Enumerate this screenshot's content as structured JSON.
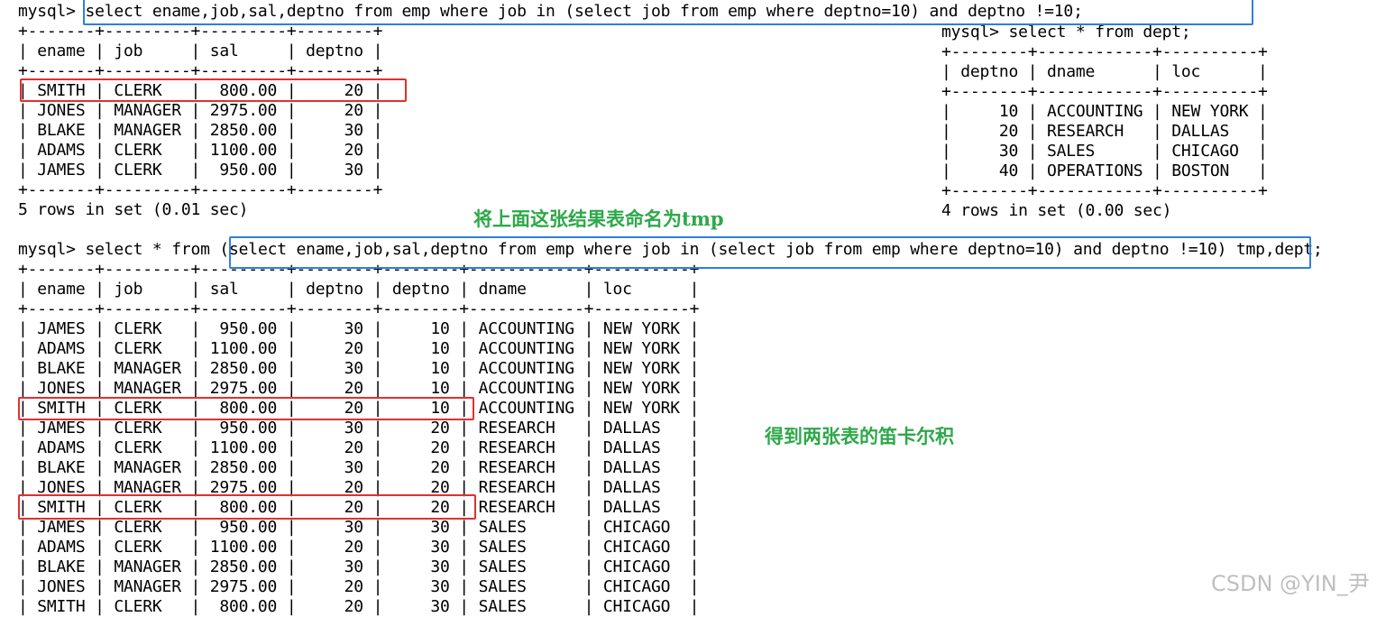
{
  "colors": {
    "terminal_text": "#000000",
    "annotation_green": "#2ea84a",
    "highlight_blue": "#2f7fdc",
    "highlight_red": "#e03030",
    "watermark": "#bfbfbf"
  },
  "query1": {
    "prompt": "mysql>",
    "sql": "select ename,job,sal,deptno from emp where job in (select job from emp where deptno=10) and deptno !=10;",
    "lines": [
      "+-------+---------+---------+--------+",
      "| ename | job     | sal     | deptno |",
      "+-------+---------+---------+--------+",
      "| SMITH | CLERK   |  800.00 |     20 |",
      "| JONES | MANAGER | 2975.00 |     20 |",
      "| BLAKE | MANAGER | 2850.00 |     30 |",
      "| ADAMS | CLERK   | 1100.00 |     20 |",
      "| JAMES | CLERK   |  950.00 |     30 |",
      "+-------+---------+---------+--------+",
      "5 rows in set (0.01 sec)"
    ]
  },
  "query2": {
    "prompt": "mysql> select * from dept;",
    "lines": [
      "+--------+------------+----------+",
      "| deptno | dname      | loc      |",
      "+--------+------------+----------+",
      "|     10 | ACCOUNTING | NEW YORK |",
      "|     20 | RESEARCH   | DALLAS   |",
      "|     30 | SALES      | CHICAGO  |",
      "|     40 | OPERATIONS | BOSTON   |",
      "+--------+------------+----------+",
      "4 rows in set (0.00 sec)"
    ]
  },
  "query3": {
    "prompt": "mysql> select * from",
    "sql": "(select ename,job,sal,deptno from emp where job in (select job from emp where deptno=10) and deptno !=10) tmp",
    "suffix": ",dept;",
    "lines": [
      "+-------+---------+---------+--------+--------+------------+----------+",
      "| ename | job     | sal     | deptno | deptno | dname      | loc      |",
      "+-------+---------+---------+--------+--------+------------+----------+",
      "| JAMES | CLERK   |  950.00 |     30 |     10 | ACCOUNTING | NEW YORK |",
      "| ADAMS | CLERK   | 1100.00 |     20 |     10 | ACCOUNTING | NEW YORK |",
      "| BLAKE | MANAGER | 2850.00 |     30 |     10 | ACCOUNTING | NEW YORK |",
      "| JONES | MANAGER | 2975.00 |     20 |     10 | ACCOUNTING | NEW YORK |",
      "| SMITH | CLERK   |  800.00 |     20 |     10 | ACCOUNTING | NEW YORK |",
      "| JAMES | CLERK   |  950.00 |     30 |     20 | RESEARCH   | DALLAS   |",
      "| ADAMS | CLERK   | 1100.00 |     20 |     20 | RESEARCH   | DALLAS   |",
      "| BLAKE | MANAGER | 2850.00 |     30 |     20 | RESEARCH   | DALLAS   |",
      "| JONES | MANAGER | 2975.00 |     20 |     20 | RESEARCH   | DALLAS   |",
      "| SMITH | CLERK   |  800.00 |     20 |     20 | RESEARCH   | DALLAS   |",
      "| JAMES | CLERK   |  950.00 |     30 |     30 | SALES      | CHICAGO  |",
      "| ADAMS | CLERK   | 1100.00 |     20 |     30 | SALES      | CHICAGO  |",
      "| BLAKE | MANAGER | 2850.00 |     30 |     30 | SALES      | CHICAGO  |",
      "| JONES | MANAGER | 2975.00 |     20 |     30 | SALES      | CHICAGO  |",
      "| SMITH | CLERK   |  800.00 |     20 |     30 | SALES      | CHICAGO  |"
    ]
  },
  "annotations": {
    "name_result_tmp": "将上面这张结果表命名为tmp",
    "cartesian_product": "得到两张表的笛卡尔积"
  },
  "watermark": "CSDN @YIN_尹"
}
